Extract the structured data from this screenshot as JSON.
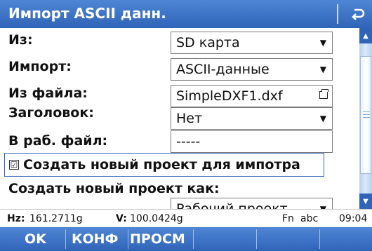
{
  "window": {
    "title": "Импорт ASCII данн.",
    "back_icon": "return-arrow-icon"
  },
  "form": {
    "from": {
      "label": "Из:",
      "value": "SD карта"
    },
    "import": {
      "label": "Импорт:",
      "value": "ASCII-данные"
    },
    "from_file": {
      "label": "Из файла:",
      "value": "SimpleDXF1.dxf"
    },
    "header": {
      "label": "Заголовок:",
      "value": "Нет"
    },
    "to_job": {
      "label": "В раб. файл:",
      "value": "-----"
    },
    "create_project": {
      "checkbox_mark": "☑",
      "label": "Создать новый проект для импотра",
      "checked": true
    },
    "create_as": {
      "label": "Создать новый проект как:",
      "value": "Рабочий проект"
    }
  },
  "status": {
    "hz_label": "Hz:",
    "hz_value": "161.2711g",
    "v_label": "V:",
    "v_value": "100.0424g",
    "mode": "Fn",
    "input_mode": "abc",
    "time": "09:04"
  },
  "softkeys": [
    {
      "label": "OK"
    },
    {
      "label": "КОНФ"
    },
    {
      "label": "ПРОСМ"
    }
  ],
  "colors": {
    "accent": "#2f64b8",
    "accent_light": "#4f86d4"
  }
}
